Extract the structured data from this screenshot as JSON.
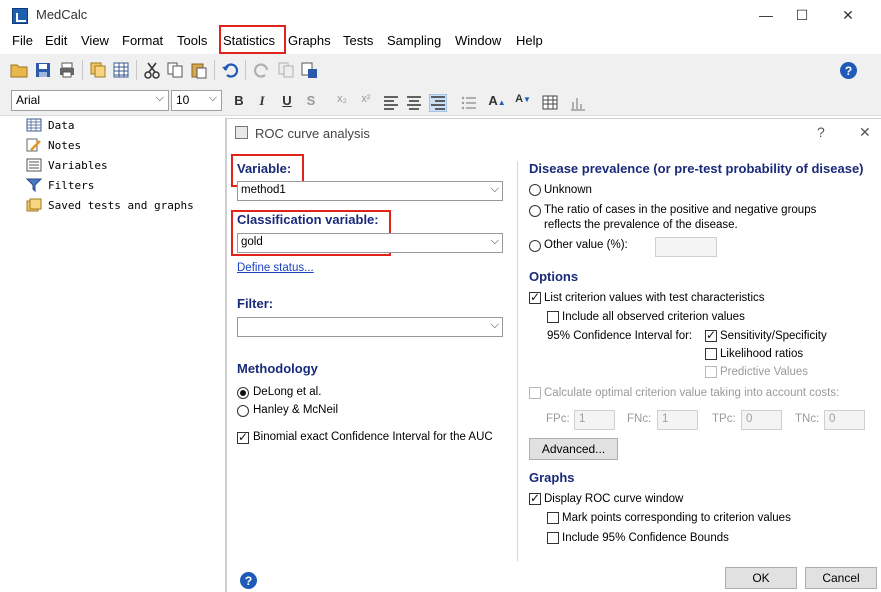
{
  "app": {
    "title": "MedCalc"
  },
  "window_controls": {
    "minimize": "—",
    "maximize": "☐",
    "close": "✕"
  },
  "menu": [
    "File",
    "Edit",
    "View",
    "Format",
    "Tools",
    "Statistics",
    "Graphs",
    "Tests",
    "Sampling",
    "Window",
    "Help"
  ],
  "format_bar": {
    "font": "Arial",
    "size": "10"
  },
  "tree": [
    "Data",
    "Notes",
    "Variables",
    "Filters",
    "Saved tests and graphs"
  ],
  "dialog": {
    "title": "ROC curve analysis",
    "help_mark": "?",
    "close": "✕",
    "variable": {
      "label": "Variable:",
      "value": "method1"
    },
    "classification": {
      "label": "Classification variable:",
      "value": "gold",
      "define_status": "Define status..."
    },
    "filter": {
      "label": "Filter:",
      "value": ""
    },
    "methodology": {
      "title": "Methodology",
      "delong": "DeLong et al.",
      "hanley": "Hanley & McNeil",
      "binomial": "Binomial exact Confidence Interval for the AUC"
    },
    "prevalence": {
      "title": "Disease prevalence (or pre-test probability of disease)",
      "unknown": "Unknown",
      "ratio_line1": "The ratio of cases in the positive and negative groups",
      "ratio_line2": "reflects the prevalence of the disease.",
      "other": "Other value (%):",
      "other_value": ""
    },
    "options": {
      "title": "Options",
      "list_criterion": "List criterion values with test characteristics",
      "include_all": "Include all observed criterion values",
      "ci_for": "95% Confidence Interval for:",
      "sens_spec": "Sensitivity/Specificity",
      "likelihood": "Likelihood ratios",
      "predictive": "Predictive Values",
      "optimal": "Calculate optimal criterion value taking into account costs:",
      "fpc_label": "FPc:",
      "fpc": "1",
      "fnc_label": "FNc:",
      "fnc": "1",
      "tpc_label": "TPc:",
      "tpc": "0",
      "tnc_label": "TNc:",
      "tnc": "0",
      "advanced": "Advanced..."
    },
    "graphs": {
      "title": "Graphs",
      "display_roc": "Display ROC curve window",
      "mark_points": "Mark points corresponding to criterion values",
      "include_ci": "Include 95% Confidence Bounds"
    },
    "ok": "OK",
    "cancel": "Cancel"
  },
  "colors": {
    "highlight": "#e0231b",
    "heading": "#1a2a7a",
    "help": "#1e5bb8"
  }
}
